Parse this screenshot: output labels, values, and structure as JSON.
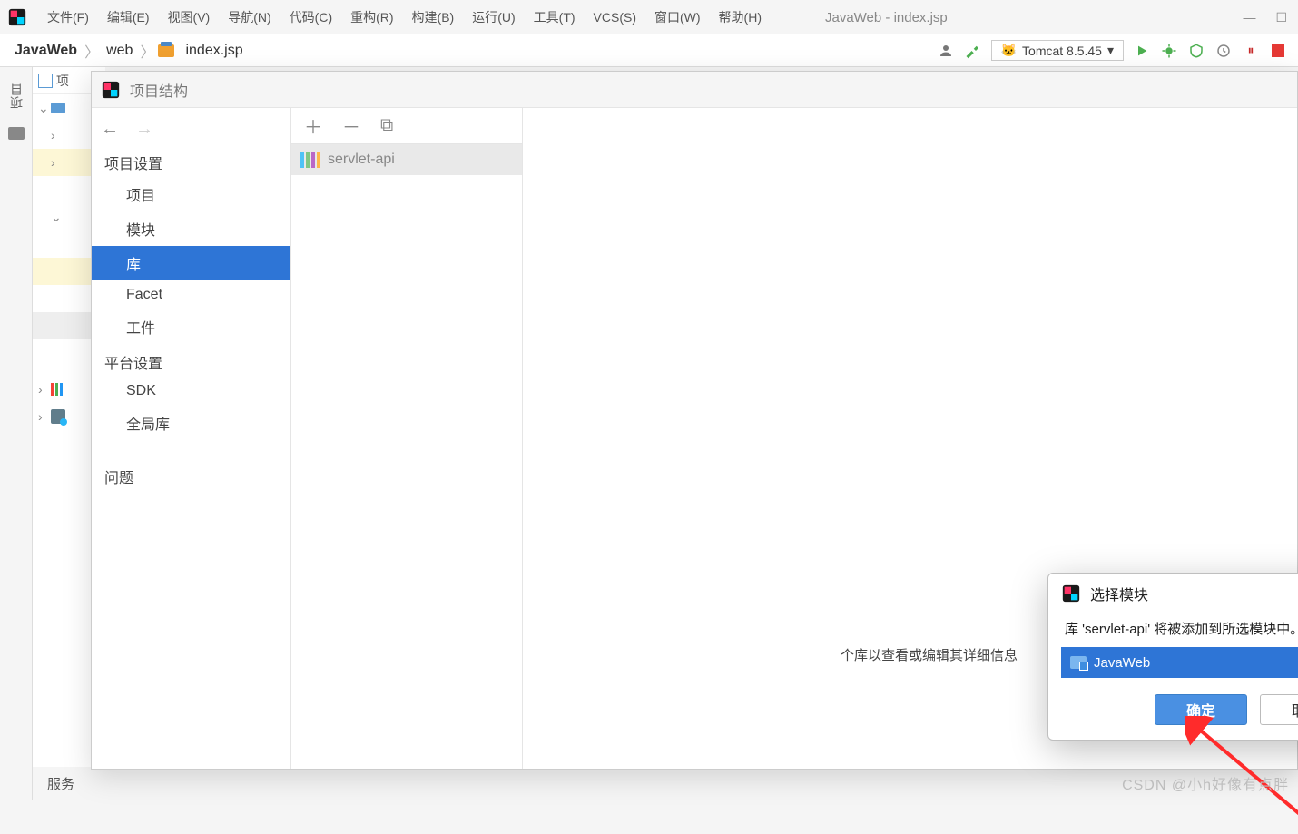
{
  "mainWindow": {
    "title": "JavaWeb - index.jsp",
    "menus": [
      "文件(F)",
      "编辑(E)",
      "视图(V)",
      "导航(N)",
      "代码(C)",
      "重构(R)",
      "构建(B)",
      "运行(U)",
      "工具(T)",
      "VCS(S)",
      "窗口(W)",
      "帮助(H)"
    ],
    "breadcrumb": [
      "JavaWeb",
      "web",
      "index.jsp"
    ],
    "runConfig": "Tomcat 8.5.45",
    "leftRail": {
      "projectLabel": "项目"
    },
    "bottomTab": "服务",
    "watermark": "CSDN @小h好像有点胖"
  },
  "psDialog": {
    "title": "项目结构",
    "nav": {
      "sectionA": "项目设置",
      "itemsA": [
        "项目",
        "模块",
        "库",
        "Facet",
        "工件"
      ],
      "sectionB": "平台设置",
      "itemsB": [
        "SDK",
        "全局库"
      ],
      "sectionC": "问题",
      "selected": "库"
    },
    "midList": {
      "library": "servlet-api"
    },
    "mainHint": "个库以查看或编辑其详细信息"
  },
  "modal": {
    "title": "选择模块",
    "message": "库 'servlet-api' 将被添加到所选模块中。",
    "item": "JavaWeb",
    "ok": "确定",
    "cancel": "取消"
  }
}
